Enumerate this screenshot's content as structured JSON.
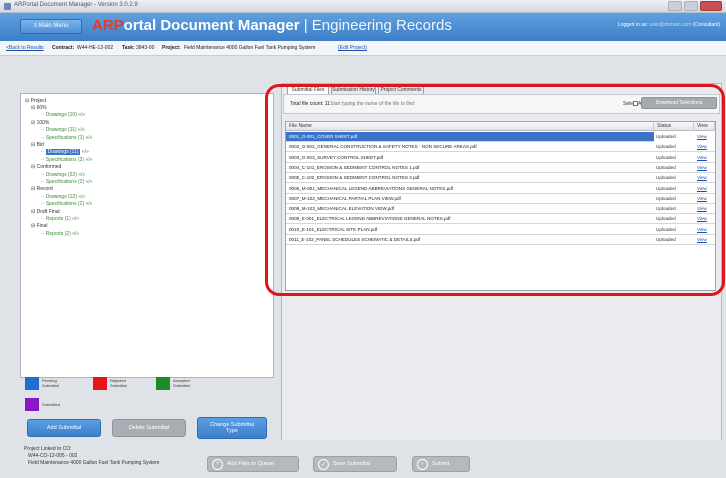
{
  "window": {
    "title": "ARPortal Document Manager - Version 3.0.2.9"
  },
  "header": {
    "menu_label": "≡ Main Menu",
    "title_logo": "ARP",
    "title_main": "ortal Document Manager",
    "title_sep": " | ",
    "title_section": "Engineering Records",
    "logged_in_prefix": "Logged in as:",
    "logged_in_user": "user@domain.com",
    "logged_in_role": "(Consultant)"
  },
  "infobar": {
    "back_link": "<Back to Results",
    "contract_label": "Contract:",
    "contract_value": "W44-HE-12-002",
    "task_label": "Task:",
    "task_value": "3843-00",
    "project_label": "Project:",
    "project_value": "Field Maintenance 4000 Gallon Fuel Tank Pumping System",
    "edit_project": "(Edit Project)"
  },
  "tree": {
    "root": "Project",
    "nodes": [
      {
        "label": "60%",
        "level": 1
      },
      {
        "label": "Drawings (10) «/»",
        "level": 2,
        "leaf": true
      },
      {
        "label": "100%",
        "level": 1
      },
      {
        "label": "Drawings (11) «/»",
        "level": 2,
        "leaf": true
      },
      {
        "label": "Specifications (1) «/»",
        "level": 2,
        "leaf": true
      },
      {
        "label": "Bid",
        "level": 1
      },
      {
        "label": "Drawings (11)",
        "suffix": " «/»",
        "level": 2,
        "leaf": true,
        "selected": true
      },
      {
        "label": "Specifications (2) «/»",
        "level": 2,
        "leaf": true
      },
      {
        "label": "Conformed",
        "level": 1
      },
      {
        "label": "Drawings (22) «/»",
        "level": 2,
        "leaf": true
      },
      {
        "label": "Specifications (2) «/»",
        "level": 2,
        "leaf": true
      },
      {
        "label": "Record",
        "level": 1
      },
      {
        "label": "Drawings (12) «/»",
        "level": 2,
        "leaf": true
      },
      {
        "label": "Specifications (2) «/»",
        "level": 2,
        "leaf": true
      },
      {
        "label": "Draft Final",
        "level": 1
      },
      {
        "label": "Reports (1) «/»",
        "level": 2,
        "leaf": true
      },
      {
        "label": "Final",
        "level": 1
      },
      {
        "label": "Reports (2) «/»",
        "level": 2,
        "leaf": true
      }
    ]
  },
  "legend": {
    "pending": "Pending Submittal",
    "rejected": "Rejected Submittal",
    "accepted": "Accepted Submittal",
    "submitted": "Submitted",
    "colors": {
      "pending": "#1f6fd1",
      "rejected": "#e8141c",
      "accepted": "#1e8a2a",
      "submitted": "#8a16c8"
    }
  },
  "actions": {
    "add_submittal": "Add Submittal",
    "delete_submittal": "Delete Submittal",
    "change_submittal_type": "Change Submittal Type"
  },
  "tabs": [
    "Submittal Files",
    "Submission History",
    "Project Comments"
  ],
  "toolbar": {
    "file_count": "Total file count: 11",
    "search_placeholder": "Start typing the name of the file to find",
    "select_all": "Select All",
    "download": "Download Selections"
  },
  "grid": {
    "columns": [
      "File Name",
      "Status",
      "View"
    ],
    "rows": [
      {
        "name": "0001_G-001_COVER SHEET.pdf",
        "status": "Uploaded",
        "view": "View",
        "selected": true
      },
      {
        "name": "0002_G-002_GENERAL CONSTRUCTION & SAFETY NOTES - NON SECURE AREAS.pdf",
        "status": "Uploaded",
        "view": "View"
      },
      {
        "name": "0003_G-003_SURVEY CONTROL SHEET.pdf",
        "status": "Uploaded",
        "view": "View"
      },
      {
        "name": "0004_C-101_EROSION & SEDIMENT CONTROL NOTES 1.pdf",
        "status": "Uploaded",
        "view": "View"
      },
      {
        "name": "0005_C-102_EROSION & SEDIMENT CONTROL NOTES 2.pdf",
        "status": "Uploaded",
        "view": "View"
      },
      {
        "name": "0006_M-001_MECHANICAL LEGEND ABBREVIATIONS GENERAL NOTES.pdf",
        "status": "Uploaded",
        "view": "View"
      },
      {
        "name": "0007_M-102_MECHANICAL PARTIAL PLAN VIEW.pdf",
        "status": "Uploaded",
        "view": "View"
      },
      {
        "name": "0008_M-103_MECHANICAL ELEVATION VIEW.pdf",
        "status": "Uploaded",
        "view": "View"
      },
      {
        "name": "0009_E-001_ELECTRICAL LEGEND ABBREVIATIONS GENERAL NOTES.pdf",
        "status": "Uploaded",
        "view": "View"
      },
      {
        "name": "0010_E-101_ELECTRICAL SITE PLAN.pdf",
        "status": "Uploaded",
        "view": "View"
      },
      {
        "name": "0011_E-102_PANEL SCHEDULES SCHEMATIC & DETAILS.pdf",
        "status": "Uploaded",
        "view": "View"
      }
    ]
  },
  "bottom": {
    "linked_label": "Project Linked to CO:",
    "linked_co": "W44-CO-12-005 - 002",
    "linked_project": "Field Maintenance 4000 Gallon Fuel Tank Pumping System",
    "add_to_queue": "Add Files to Queue",
    "save_submittal": "Save Submittal",
    "submit": "Submit"
  }
}
